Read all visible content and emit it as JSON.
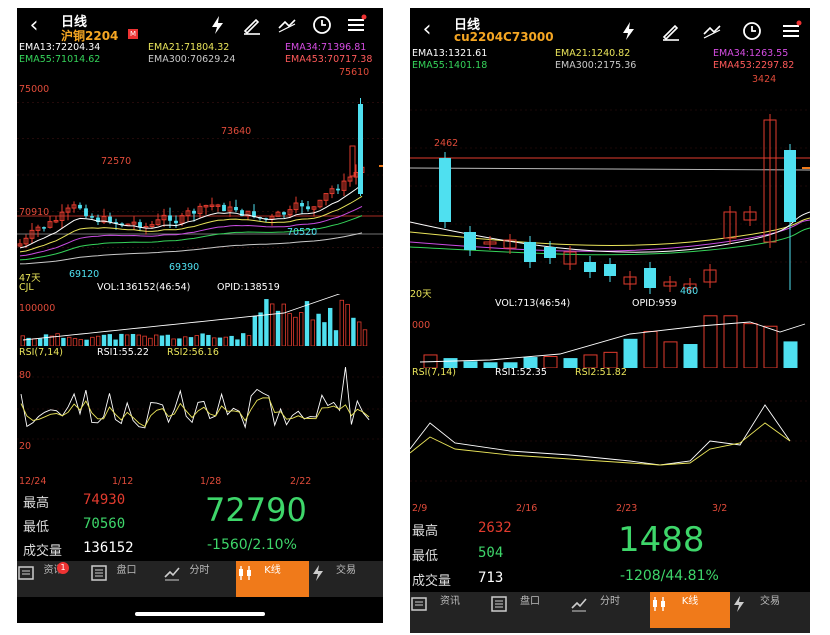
{
  "colors": {
    "up": "#e23b2e",
    "down": "#4fe0f0",
    "ema13": "#ffffff",
    "ema21": "#e9e45a",
    "ema34": "#c94de3",
    "ema55": "#35d35a",
    "ema300": "#c9c9c9",
    "ema453": "#ff5a5a",
    "accent": "#f07a1a",
    "price": "#3ed66a"
  },
  "screen1": {
    "title": "日线",
    "symbol": "沪铜2204",
    "ema": {
      "ema13": "EMA13:72204.34",
      "ema21": "EMA21:71804.32",
      "ema34": "EMA34:71396.81",
      "ema55": "EMA55:71014.62",
      "ema300": "EMA300:70629.24",
      "ema453": "EMA453:70717.38"
    },
    "price_labels": [
      "75000",
      "75610",
      "73640",
      "72570",
      "70910",
      "70520",
      "69390",
      "69120",
      "47天"
    ],
    "cjl": {
      "label": "CJL",
      "vol": "VOL:136152(46:54)",
      "opid": "OPID:138519",
      "axis": "100000"
    },
    "rsi": {
      "label": "RSI(7,14)",
      "rsi1": "RSI1:55.22",
      "rsi2": "RSI2:56.16",
      "axis_hi": "80",
      "axis_lo": "20"
    },
    "dates": [
      "12/24",
      "1/12",
      "1/28",
      "2/22"
    ],
    "stats": {
      "high_label": "最高",
      "high": "74930",
      "low_label": "最低",
      "low": "70560",
      "vol_label": "成交量",
      "vol": "136152"
    },
    "last_price": "72790",
    "change": "-1560/2.10%",
    "tabs": [
      {
        "label": "资讯",
        "icon": "news-icon",
        "badge": "1"
      },
      {
        "label": "盘口",
        "icon": "orderbook-icon"
      },
      {
        "label": "分时",
        "icon": "timeshare-icon"
      },
      {
        "label": "K线",
        "icon": "kline-icon"
      },
      {
        "label": "交易",
        "icon": "trade-icon"
      }
    ]
  },
  "screen2": {
    "title": "日线",
    "symbol": "cu2204C73000",
    "ema": {
      "ema13": "EMA13:1321.61",
      "ema21": "EMA21:1240.82",
      "ema34": "EMA34:1263.55",
      "ema55": "EMA55:1401.18",
      "ema300": "EMA300:2175.36",
      "ema453": "EMA453:2297.82"
    },
    "price_labels": [
      "3424",
      "2462",
      "460",
      "20天"
    ],
    "cjl": {
      "vol": "VOL:713(46:54)",
      "opid": "OPID:959",
      "axis": "000"
    },
    "rsi": {
      "label": "RSI(7,14)",
      "rsi1": "RSI1:52.35",
      "rsi2": "RSI2:51.82"
    },
    "dates": [
      "2/9",
      "2/16",
      "2/23",
      "3/2"
    ],
    "stats": {
      "high_label": "最高",
      "high": "2632",
      "low_label": "最低",
      "low": "504",
      "vol_label": "成交量",
      "vol": "713"
    },
    "last_price": "1488",
    "change": "-1208/44.81%",
    "tabs": [
      {
        "label": "资讯",
        "icon": "news-icon"
      },
      {
        "label": "盘口",
        "icon": "orderbook-icon"
      },
      {
        "label": "分时",
        "icon": "timeshare-icon"
      },
      {
        "label": "K线",
        "icon": "kline-icon"
      },
      {
        "label": "交易",
        "icon": "trade-icon"
      }
    ]
  }
}
